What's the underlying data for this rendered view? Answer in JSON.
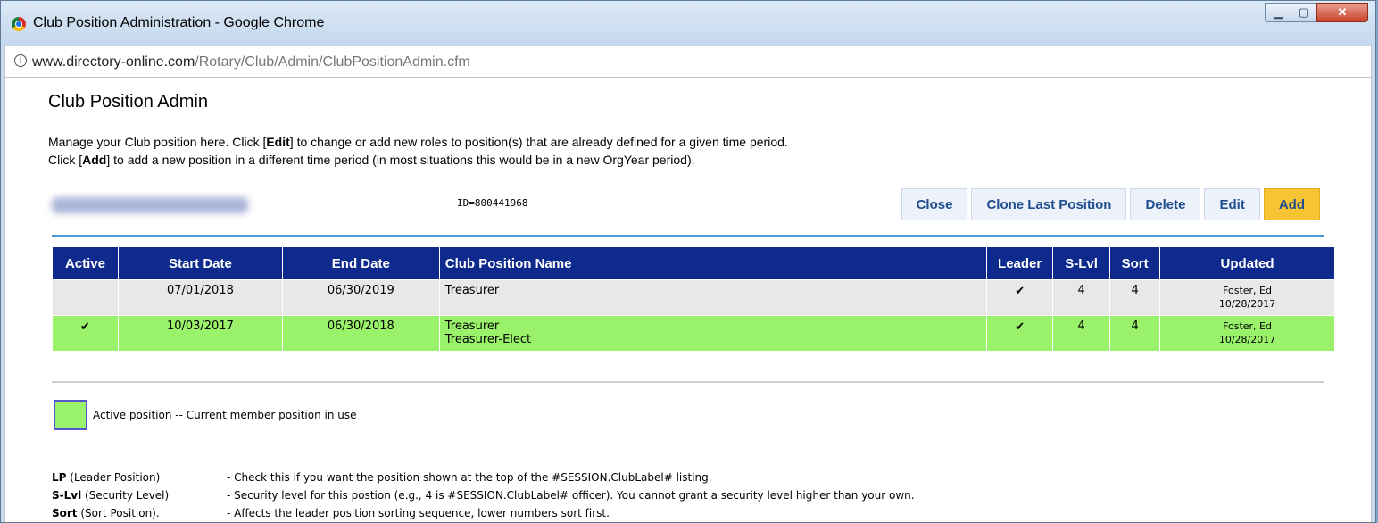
{
  "window": {
    "title": "Club Position Administration - Google Chrome",
    "url_host": "www.directory-online.com",
    "url_path": "/Rotary/Club/Admin/ClubPositionAdmin.cfm"
  },
  "page": {
    "title": "Club Position Admin",
    "desc1_a": "Manage your Club position here. Click [",
    "desc1_b": "Edit",
    "desc1_c": "] to change or add new roles to position(s) that are already defined for a given time period.",
    "desc2_a": "Click [",
    "desc2_b": "Add",
    "desc2_c": "] to add a new position in a different time period (in most situations this would be in a new OrgYear period).",
    "member_id": "ID=800441968"
  },
  "buttons": {
    "close": "Close",
    "clone": "Clone Last Position",
    "delete": "Delete",
    "edit": "Edit",
    "add": "Add"
  },
  "table": {
    "headers": {
      "active": "Active",
      "start": "Start Date",
      "end": "End Date",
      "name": "Club Position Name",
      "leader": "Leader",
      "slvl": "S-Lvl",
      "sort": "Sort",
      "updated": "Updated"
    },
    "rows": [
      {
        "active": "",
        "start": "07/01/2018",
        "end": "06/30/2019",
        "name1": "Treasurer",
        "name2": "",
        "leader": "✔",
        "slvl": "4",
        "sort": "4",
        "upd_by": "Foster, Ed",
        "upd_date": "10/28/2017"
      },
      {
        "active": "✔",
        "start": "10/03/2017",
        "end": "06/30/2018",
        "name1": "Treasurer",
        "name2": "Treasurer-Elect",
        "leader": "✔",
        "slvl": "4",
        "sort": "4",
        "upd_by": "Foster, Ed",
        "upd_date": "10/28/2017"
      }
    ]
  },
  "legend": {
    "text": "Active position -- Current member position in use",
    "color": "#99f26a"
  },
  "notes": [
    {
      "abbr": "LP",
      "term": " (Leader Position)",
      "text": "- Check this if you want the position shown at the top of the #SESSION.ClubLabel# listing."
    },
    {
      "abbr": "S-Lvl",
      "term": " (Security Level)",
      "text": "- Security level for this postion (e.g., 4 is #SESSION.ClubLabel# officer). You cannot grant a security level higher than your own."
    },
    {
      "abbr": "Sort",
      "term": " (Sort Position).",
      "text": "- Affects the leader position sorting sequence, lower numbers sort first."
    }
  ],
  "colors": {
    "header_bg": "#0e2a8c",
    "active_row": "#99f26a",
    "add_button": "#f7c433",
    "accent_rule": "#4a9bd3"
  }
}
